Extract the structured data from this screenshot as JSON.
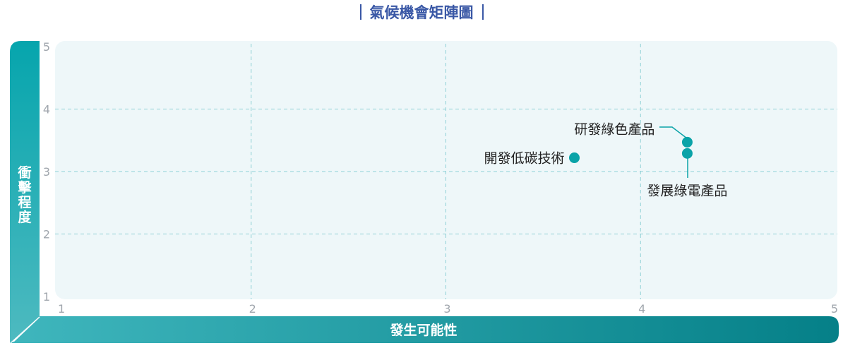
{
  "chart_data": {
    "type": "scatter",
    "title": "氣候機會矩陣圖",
    "xlabel": "發生可能性",
    "ylabel": "衝擊程度",
    "xlim": [
      1,
      5
    ],
    "ylim": [
      1,
      5
    ],
    "xticks": [
      "1",
      "2",
      "3",
      "4",
      "5"
    ],
    "yticks": [
      "1",
      "2",
      "3",
      "4",
      "5"
    ],
    "grid": true,
    "points": [
      {
        "label": "研發綠色產品",
        "x": 4.24,
        "y": 3.47
      },
      {
        "label": "發展綠電產品",
        "x": 4.24,
        "y": 3.29
      },
      {
        "label": "開發低碳技術",
        "x": 3.66,
        "y": 3.22
      }
    ]
  },
  "colors": {
    "title": "#3a58a6",
    "accent": "#0aa3a8",
    "accent_dark": "#007f86",
    "plot_bg": "#eef7f9",
    "grid": "#8fd0d6",
    "tick": "#a0a6ad"
  }
}
